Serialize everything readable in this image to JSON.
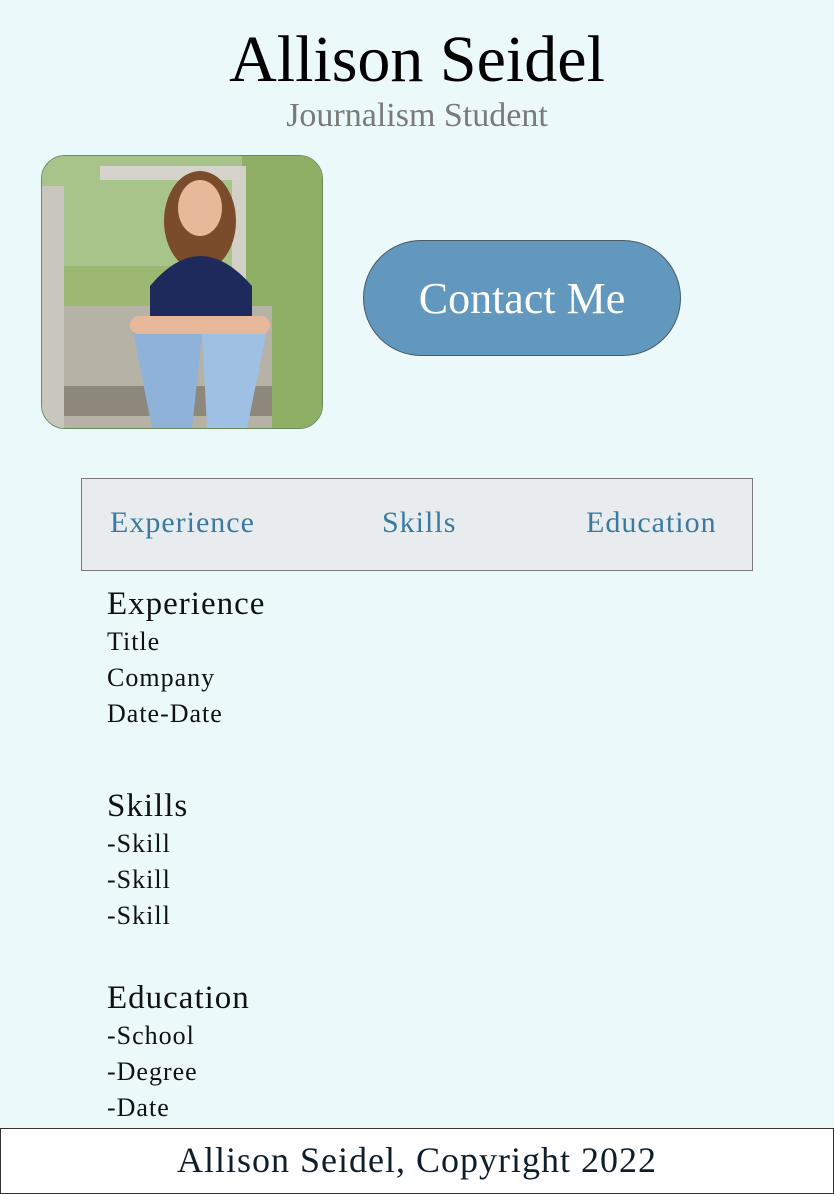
{
  "header": {
    "name": "Allison Seidel",
    "subtitle": "Journalism Student"
  },
  "contact_button": {
    "label": "Contact Me",
    "color": "#6298bd"
  },
  "tabs": [
    {
      "label": "Experience"
    },
    {
      "label": "Skills"
    },
    {
      "label": "Education"
    }
  ],
  "experience": {
    "heading": "Experience",
    "lines": [
      "Title",
      "Company",
      "Date-Date"
    ]
  },
  "skills": {
    "heading": "Skills",
    "lines": [
      "-Skill",
      "-Skill",
      "-Skill"
    ]
  },
  "education": {
    "heading": "Education",
    "lines": [
      "-School",
      "-Degree",
      "-Date"
    ]
  },
  "footer": {
    "text": "Allison Seidel, Copyright 2022"
  },
  "colors": {
    "background": "#ebf9fb",
    "tab_text": "#3a7aa0",
    "subtitle": "#7a7a7a"
  }
}
